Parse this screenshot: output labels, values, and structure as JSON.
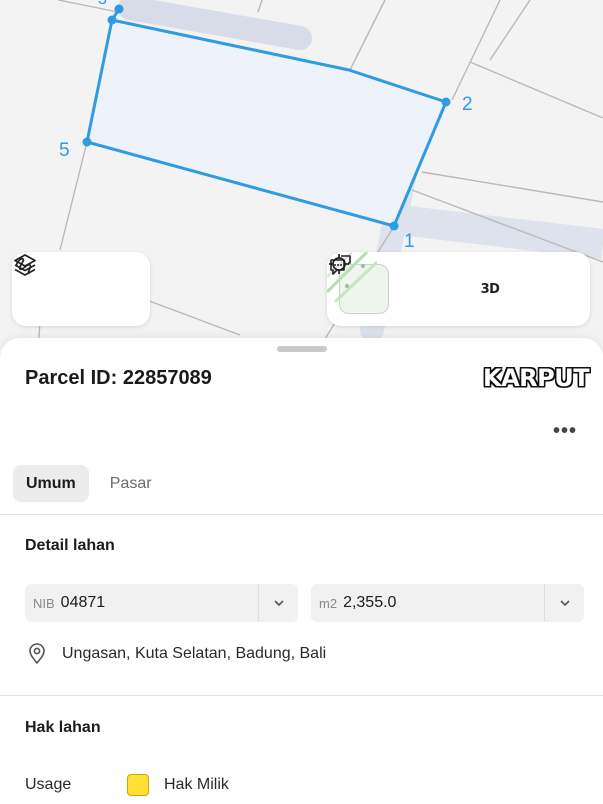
{
  "map": {
    "vertex_labels": [
      "2",
      "5",
      "1"
    ],
    "parcel_color": "#2f9be0",
    "parcel_fill": "#eef3fb"
  },
  "map_tools": {
    "left": [
      {
        "icon": "layers-icon"
      },
      {
        "icon": "measure-icon"
      }
    ],
    "right": [
      {
        "icon": "basemap-thumbnail"
      },
      {
        "icon": "crosshair-icon"
      },
      {
        "label": "3D"
      },
      {
        "icon": "chat-icon"
      }
    ]
  },
  "parcel": {
    "title": "Parcel ID: 22857089",
    "brand": "KARPUT",
    "more": "•••"
  },
  "tabs": [
    {
      "label": "Umum",
      "active": true
    },
    {
      "label": "Pasar",
      "active": false
    }
  ],
  "detail": {
    "title": "Detail lahan",
    "nib": {
      "prefix": "NIB",
      "value": "04871"
    },
    "area": {
      "prefix": "m2",
      "value": "2,355.0"
    },
    "address": "Ungasan, Kuta Selatan, Badung, Bali"
  },
  "rights": {
    "title": "Hak lahan",
    "usage_label": "Usage",
    "usage_value": "Hak Milik",
    "usage_color": "#ffe033"
  }
}
